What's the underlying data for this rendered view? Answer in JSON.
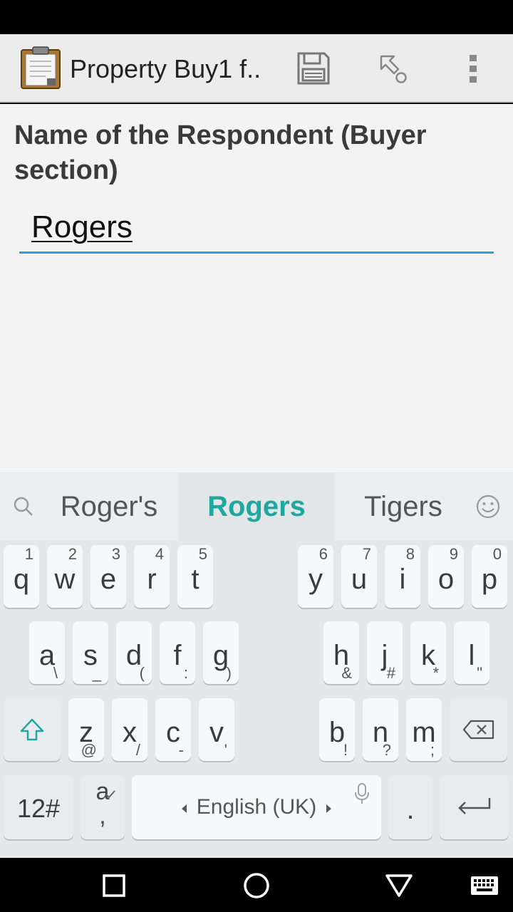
{
  "app": {
    "title": "Property Buy1 f..",
    "clipboard_icon": "clipboard-icon",
    "save_icon": "floppy-disk-icon",
    "goto_icon": "jump-arrow-icon",
    "menu_icon": "overflow-menu-icon"
  },
  "form": {
    "question": "Name of the Respondent (Buyer section)",
    "answer": "Rogers"
  },
  "keyboard": {
    "suggestions": [
      "Roger's",
      "Rogers",
      "Tigers"
    ],
    "row1": [
      {
        "k": "q",
        "n": "1"
      },
      {
        "k": "w",
        "n": "2"
      },
      {
        "k": "e",
        "n": "3"
      },
      {
        "k": "r",
        "n": "4"
      },
      {
        "k": "t",
        "n": "5"
      },
      {
        "k": "y",
        "n": "6"
      },
      {
        "k": "u",
        "n": "7"
      },
      {
        "k": "i",
        "n": "8"
      },
      {
        "k": "o",
        "n": "9"
      },
      {
        "k": "p",
        "n": "0"
      }
    ],
    "row2": [
      {
        "k": "a",
        "s": "\\"
      },
      {
        "k": "s",
        "s": "_"
      },
      {
        "k": "d",
        "s": "("
      },
      {
        "k": "f",
        "s": ":"
      },
      {
        "k": "g",
        "s": ")"
      },
      {
        "k": "h",
        "s": "&"
      },
      {
        "k": "j",
        "s": "#"
      },
      {
        "k": "k",
        "s": "*"
      },
      {
        "k": "l",
        "s": "\""
      }
    ],
    "row3": [
      {
        "k": "z",
        "s": "@"
      },
      {
        "k": "x",
        "s": "/"
      },
      {
        "k": "c",
        "s": "-"
      },
      {
        "k": "v",
        "s": "'"
      },
      {
        "k": "b",
        "s": "!"
      },
      {
        "k": "n",
        "s": "?"
      },
      {
        "k": "m",
        "s": ";"
      }
    ],
    "symbols_label": "12#",
    "punct_top": "a",
    "punct_bottom": ",",
    "space_label": "English (UK)",
    "period_label": ".",
    "accent_color": "#1fa89f"
  },
  "navigation": {
    "recents_icon": "square-icon",
    "home_icon": "circle-icon",
    "back_icon": "triangle-icon",
    "keyboard_icon": "keyboard-icon"
  }
}
